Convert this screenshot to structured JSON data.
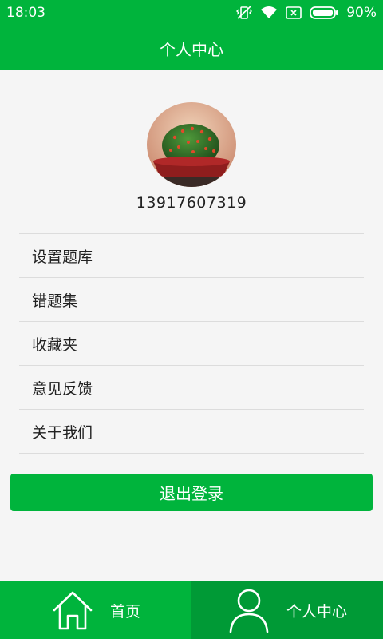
{
  "status_bar": {
    "time": "18:03",
    "battery": "90%",
    "icons": [
      "vibrate-icon",
      "wifi-icon",
      "sim-icon",
      "battery-icon"
    ]
  },
  "header": {
    "title": "个人中心"
  },
  "profile": {
    "phone": "13917607319"
  },
  "menu": {
    "items": [
      {
        "label": "设置题库"
      },
      {
        "label": "错题集"
      },
      {
        "label": "收藏夹"
      },
      {
        "label": "意见反馈"
      },
      {
        "label": "关于我们"
      }
    ]
  },
  "logout": {
    "label": "退出登录"
  },
  "tabs": [
    {
      "label": "首页",
      "icon": "home-icon"
    },
    {
      "label": "个人中心",
      "icon": "person-icon",
      "active": true
    }
  ],
  "colors": {
    "primary": "#00b43c",
    "primary_dark": "#009a36",
    "background": "#f5f5f5"
  }
}
